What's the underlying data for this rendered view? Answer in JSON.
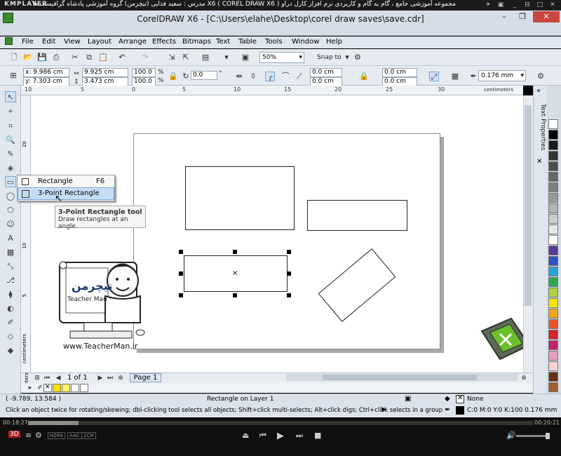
{
  "kmplayer": {
    "logo": "KMPLAYER",
    "title": "مجموعه آموزشی جامع ، گام به گام و کاربردی نرم افزار کارل دراو X6 ( COREL DRAW X6 )   مدرس : سعید فدایی (تیچرمن) گروه آموزشی پادشاه گرافیست ها",
    "time_elapsed": "00:18:27",
    "time_total": "00:20:21",
    "badges": [
      "3D",
      "H264",
      "AAC",
      "2CH"
    ]
  },
  "app": {
    "title": "CorelDRAW X6 - [C:\\Users\\elahe\\Desktop\\corel draw saves\\save.cdr]"
  },
  "menu": [
    "File",
    "Edit",
    "View",
    "Layout",
    "Arrange",
    "Effects",
    "Bitmaps",
    "Text",
    "Table",
    "Tools",
    "Window",
    "Help"
  ],
  "toolbar1": {
    "zoom": "50%",
    "snap_to": "Snap to"
  },
  "property_bar": {
    "x": "x: 9.986 cm",
    "y": "y: 7.303 cm",
    "w": "9.925 cm",
    "h": "3.473 cm",
    "scale_w": "100.0",
    "scale_h": "100.0",
    "percent": "%",
    "rotation": "0.0",
    "degree": "°",
    "corner1": "0.0 cm",
    "corner2": "0.0 cm",
    "corner3": "0.0 cm",
    "corner4": "0.0 cm",
    "outline_width": "0.176 mm"
  },
  "ruler": {
    "ticks": [
      "10",
      "5",
      "0",
      "5",
      "10",
      "15",
      "20",
      "25",
      "30"
    ],
    "unit": "centimeters",
    "left_ticks": [
      "20",
      "15",
      "10",
      "5"
    ],
    "left_unit": "centimeters"
  },
  "flyout": {
    "items": [
      {
        "label": "Rectangle",
        "shortcut": "F6"
      },
      {
        "label": "3-Point Rectangle",
        "shortcut": ""
      }
    ]
  },
  "tooltip": {
    "title": "3-Point Rectangle tool",
    "text": "Draw rectangles at an angle."
  },
  "docker": {
    "label": "Text Properties"
  },
  "page_nav": {
    "count": "1 of 1",
    "tab": "Page 1"
  },
  "status": {
    "coords": "( -9.789, 13.584 )",
    "object": "Rectangle on Layer 1",
    "hint": "Click an object twice for rotating/skewing; dbl-clicking tool selects all objects; Shift+click multi-selects; Alt+click digs; Ctrl+click selects in a group",
    "fill": "None",
    "outline": "C:0 M:0 Y:0 K:100  0.176 mm"
  },
  "watermark": {
    "url": "www.TeacherMan.ir",
    "brand": "Teacher Man",
    "brand_fa": "تیچرمن"
  },
  "palette_colors": [
    "#ffffff",
    "#000000",
    "#1a1a1a",
    "#333333",
    "#4d4d4d",
    "#666666",
    "#808080",
    "#999999",
    "#b3b3b3",
    "#cccccc",
    "#e6e6e6",
    "#ffffff",
    "#5a3aa0",
    "#2c55c4",
    "#23a5de",
    "#2ea84a",
    "#b0d13c",
    "#ffe400",
    "#f6a51d",
    "#e8532a",
    "#d4242a",
    "#c4226f",
    "#e69ec1",
    "#f7d1d0",
    "#6a2f15",
    "#a45d2a"
  ],
  "color_row": [
    "#ffe100",
    "#fff066",
    "#ffffff",
    "#ffffff"
  ]
}
